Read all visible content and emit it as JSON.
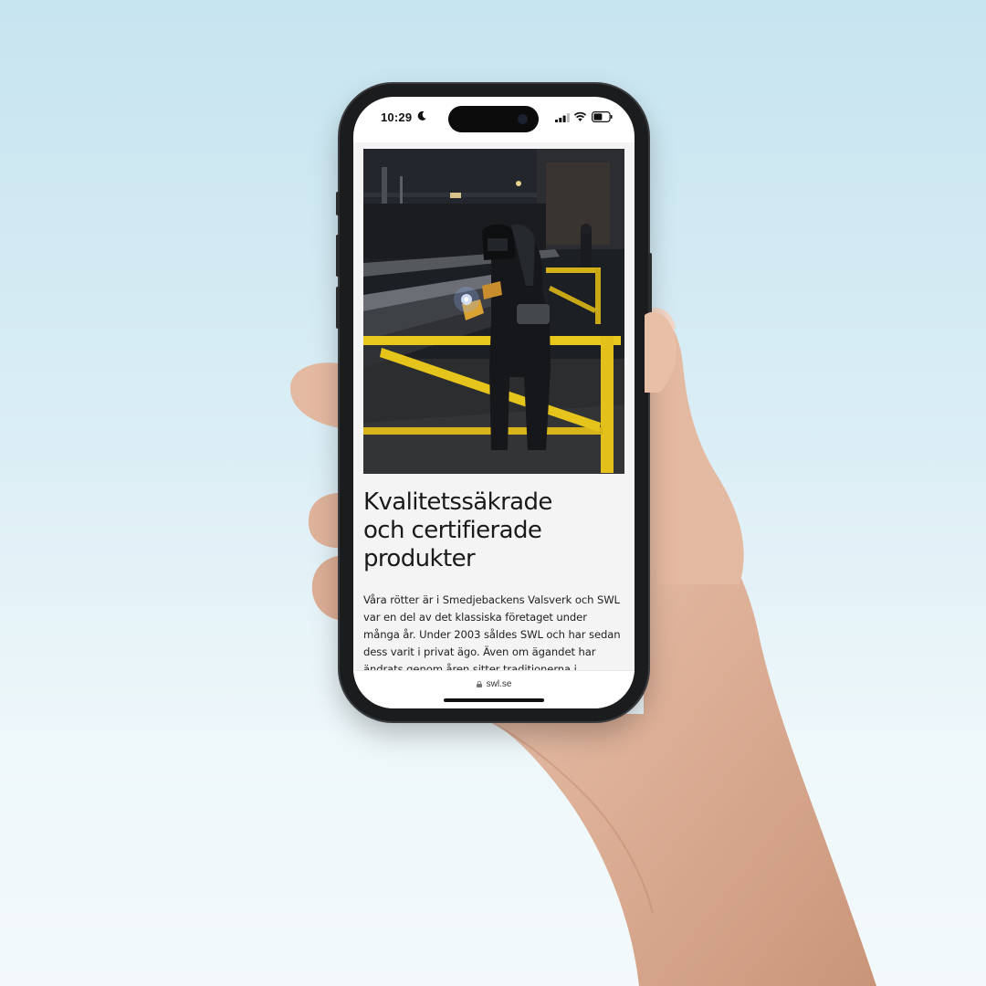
{
  "status_bar": {
    "time": "10:29",
    "icons": [
      "moon-icon",
      "cellular-signal-icon",
      "wifi-icon",
      "battery-icon"
    ]
  },
  "article": {
    "image": "welder-at-work-photo",
    "headline_lines": [
      "Kvalitetssäkrade",
      "och certifierade",
      "produkter"
    ],
    "body_lines": [
      "Våra rötter är i Smedjebackens Valsverk och SWL",
      "var en del av det klassiska företaget under",
      "många år. Under 2003 såldes SWL och har sedan",
      "dess varit i privat ägo. Även om ägandet har",
      "ändrats genom åren sitter traditionerna i"
    ]
  },
  "browser": {
    "url": "swl.se",
    "icon": "lock-icon"
  },
  "colors": {
    "background_top": "#c6e4f0",
    "background_bottom": "#f3f9fb",
    "phone_frame": "#1b1c1e",
    "page_background": "#f4f4f4",
    "rail_yellow": "#e8c81c"
  }
}
